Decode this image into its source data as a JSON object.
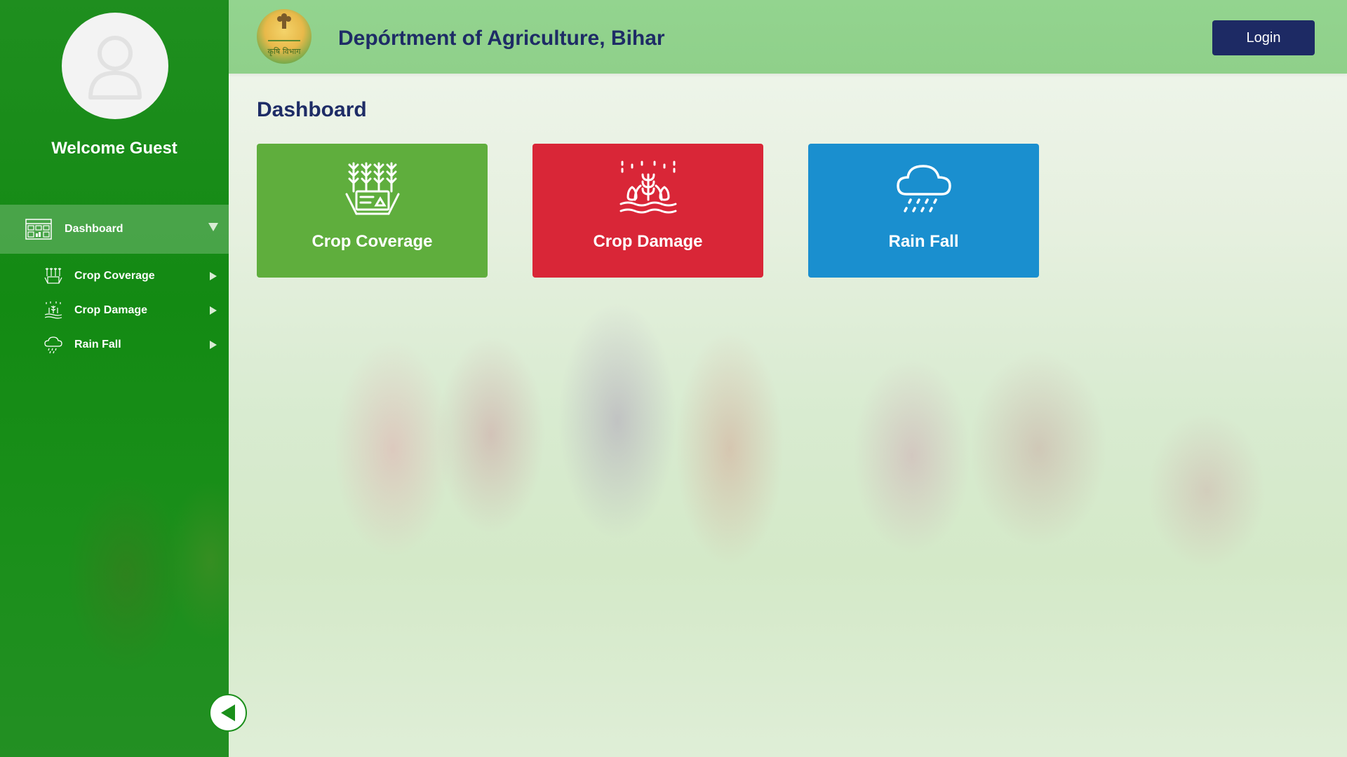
{
  "header": {
    "title": "Depórtment of Agriculture, Bihar",
    "logo_text": "कृषि विभाग",
    "login_label": "Login"
  },
  "sidebar": {
    "welcome": "Welcome Guest",
    "dashboard_label": "Dashboard",
    "items": [
      {
        "label": "Crop Coverage",
        "icon": "crop-coverage-icon"
      },
      {
        "label": "Crop Damage",
        "icon": "crop-damage-icon"
      },
      {
        "label": "Rain Fall",
        "icon": "rain-cloud-icon"
      }
    ]
  },
  "main": {
    "title": "Dashboard",
    "cards": [
      {
        "label": "Crop Coverage",
        "color": "#5fae3d",
        "icon": "crop-coverage-icon"
      },
      {
        "label": "Crop Damage",
        "color": "#d92637",
        "icon": "crop-damage-icon"
      },
      {
        "label": "Rain Fall",
        "color": "#1a8fcf",
        "icon": "rain-cloud-icon"
      }
    ]
  },
  "colors": {
    "sidebar": "#138a13",
    "header": "#93d48f",
    "navy": "#1e2c66"
  }
}
